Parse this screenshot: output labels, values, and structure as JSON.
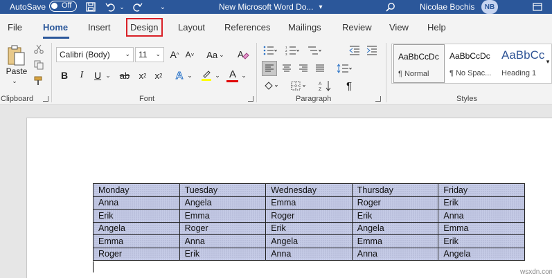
{
  "titlebar": {
    "autosave_label": "AutoSave",
    "autosave_state": "Off",
    "doc_title": "New Microsoft Word Do...",
    "user_name": "Nicolae Bochis",
    "user_initials": "NB"
  },
  "tabs": [
    {
      "label": "File"
    },
    {
      "label": "Home"
    },
    {
      "label": "Insert"
    },
    {
      "label": "Design"
    },
    {
      "label": "Layout"
    },
    {
      "label": "References"
    },
    {
      "label": "Mailings"
    },
    {
      "label": "Review"
    },
    {
      "label": "View"
    },
    {
      "label": "Help"
    }
  ],
  "active_tab": "Home",
  "highlighted_tab": "Design",
  "clipboard": {
    "paste_label": "Paste",
    "group_label": "Clipboard"
  },
  "font": {
    "font_name": "Calibri (Body)",
    "font_size": "11",
    "grow_label": "A",
    "shrink_label": "A",
    "case_label": "Aa",
    "bold": "B",
    "italic": "I",
    "underline": "U",
    "strike": "ab",
    "subscript": "x",
    "superscript": "x",
    "text_effects": "A",
    "font_color": "A",
    "group_label": "Font",
    "highlight_color": "#ffff00",
    "font_color_value": "#e00000"
  },
  "paragraph": {
    "group_label": "Paragraph",
    "pilcrow": "¶"
  },
  "styles": {
    "group_label": "Styles",
    "items": [
      {
        "sample": "AaBbCcDc",
        "name": "¶ Normal"
      },
      {
        "sample": "AaBbCcDc",
        "name": "¶ No Spac..."
      },
      {
        "sample": "AaBbCc",
        "name": "Heading 1"
      }
    ]
  },
  "table": {
    "rows": [
      [
        "Monday",
        "Tuesday",
        "Wednesday",
        "Thursday",
        "Friday"
      ],
      [
        "Anna",
        "Angela",
        "Emma",
        "Roger",
        "Erik"
      ],
      [
        "Erik",
        "Emma",
        "Roger",
        "Erik",
        "Anna"
      ],
      [
        "Angela",
        "Roger",
        "Erik",
        "Angela",
        "Emma"
      ],
      [
        "Emma",
        "Anna",
        "Angela",
        "Emma",
        "Erik"
      ],
      [
        "Roger",
        "Erik",
        "Anna",
        "Anna",
        "Angela"
      ]
    ]
  },
  "watermark": "wsxdn.com",
  "colors": {
    "titlebar": "#2b579a",
    "accent": "#2b579a",
    "design_highlight": "#d92027",
    "table_shading": "#c5cbe6"
  }
}
